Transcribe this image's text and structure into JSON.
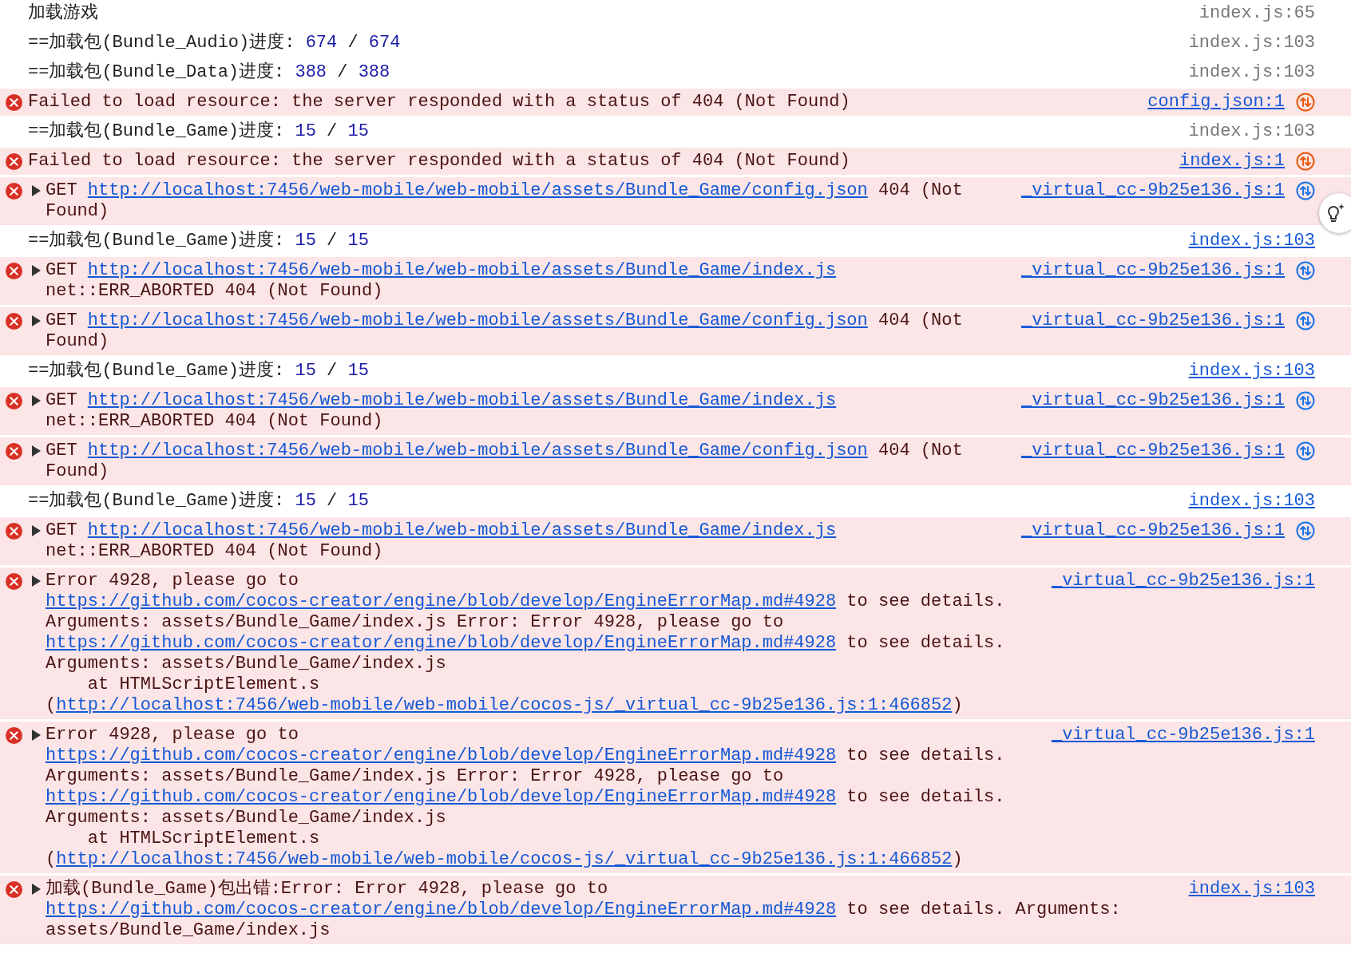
{
  "console": {
    "messages": [
      {
        "kind": "log",
        "parts": [
          {
            "kind": "text",
            "text": "加载游戏"
          }
        ],
        "source": {
          "text": "index.js:65",
          "linked": false
        }
      },
      {
        "kind": "log",
        "parts": [
          {
            "kind": "text",
            "text": "==加载包(Bundle_Audio)进度: "
          },
          {
            "kind": "number",
            "text": "674"
          },
          {
            "kind": "text",
            "text": " / "
          },
          {
            "kind": "number",
            "text": "674"
          }
        ],
        "source": {
          "text": "index.js:103",
          "linked": false
        }
      },
      {
        "kind": "log",
        "parts": [
          {
            "kind": "text",
            "text": "==加载包(Bundle_Data)进度: "
          },
          {
            "kind": "number",
            "text": "388"
          },
          {
            "kind": "text",
            "text": " / "
          },
          {
            "kind": "number",
            "text": "388"
          }
        ],
        "source": {
          "text": "index.js:103",
          "linked": false
        }
      },
      {
        "kind": "error",
        "parts": [
          {
            "kind": "text",
            "text": "Failed to load resource: the server responded with a status of 404 (Not Found)"
          }
        ],
        "source": {
          "text": "config.json:1",
          "linked": true
        },
        "network_icon": {
          "color": "#e8590c"
        }
      },
      {
        "kind": "log",
        "parts": [
          {
            "kind": "text",
            "text": "==加载包(Bundle_Game)进度: "
          },
          {
            "kind": "number",
            "text": "15"
          },
          {
            "kind": "text",
            "text": " / "
          },
          {
            "kind": "number",
            "text": "15"
          }
        ],
        "source": {
          "text": "index.js:103",
          "linked": false
        }
      },
      {
        "kind": "error",
        "parts": [
          {
            "kind": "text",
            "text": "Failed to load resource: the server responded with a status of 404 (Not Found)"
          }
        ],
        "source": {
          "text": "index.js:1",
          "linked": true
        },
        "network_icon": {
          "color": "#e8590c"
        }
      },
      {
        "kind": "error",
        "expanded": false,
        "parts": [
          {
            "kind": "text",
            "text": "GET "
          },
          {
            "kind": "link",
            "text": "http://localhost:7456/web-mobile/web-mobile/assets/Bundle_Game/config.json"
          },
          {
            "kind": "text",
            "text": " 404 (Not Found)"
          }
        ],
        "source": {
          "text": "_virtual_cc-9b25e136.js:1",
          "linked": true
        },
        "network_icon": {
          "color": "#1a73e8"
        }
      },
      {
        "kind": "log",
        "parts": [
          {
            "kind": "text",
            "text": "==加载包(Bundle_Game)进度: "
          },
          {
            "kind": "number",
            "text": "15"
          },
          {
            "kind": "text",
            "text": " / "
          },
          {
            "kind": "number",
            "text": "15"
          }
        ],
        "source": {
          "text": "index.js:103",
          "linked": true
        }
      },
      {
        "kind": "error",
        "expanded": false,
        "parts": [
          {
            "kind": "text",
            "text": "GET "
          },
          {
            "kind": "link",
            "text": "http://localhost:7456/web-mobile/web-mobile/assets/Bundle_Game/index.js"
          },
          {
            "kind": "text",
            "text": " net::ERR_ABORTED 404 (Not Found)"
          }
        ],
        "source": {
          "text": "_virtual_cc-9b25e136.js:1",
          "linked": true
        },
        "network_icon": {
          "color": "#1a73e8"
        }
      },
      {
        "kind": "error",
        "expanded": false,
        "parts": [
          {
            "kind": "text",
            "text": "GET "
          },
          {
            "kind": "link",
            "text": "http://localhost:7456/web-mobile/web-mobile/assets/Bundle_Game/config.json"
          },
          {
            "kind": "text",
            "text": " 404 (Not Found)"
          }
        ],
        "source": {
          "text": "_virtual_cc-9b25e136.js:1",
          "linked": true
        },
        "network_icon": {
          "color": "#1a73e8"
        }
      },
      {
        "kind": "log",
        "parts": [
          {
            "kind": "text",
            "text": "==加载包(Bundle_Game)进度: "
          },
          {
            "kind": "number",
            "text": "15"
          },
          {
            "kind": "text",
            "text": " / "
          },
          {
            "kind": "number",
            "text": "15"
          }
        ],
        "source": {
          "text": "index.js:103",
          "linked": true
        }
      },
      {
        "kind": "error",
        "expanded": false,
        "parts": [
          {
            "kind": "text",
            "text": "GET "
          },
          {
            "kind": "link",
            "text": "http://localhost:7456/web-mobile/web-mobile/assets/Bundle_Game/index.js"
          },
          {
            "kind": "text",
            "text": " net::ERR_ABORTED 404 (Not Found)"
          }
        ],
        "source": {
          "text": "_virtual_cc-9b25e136.js:1",
          "linked": true
        },
        "network_icon": {
          "color": "#1a73e8"
        }
      },
      {
        "kind": "error",
        "expanded": false,
        "parts": [
          {
            "kind": "text",
            "text": "GET "
          },
          {
            "kind": "link",
            "text": "http://localhost:7456/web-mobile/web-mobile/assets/Bundle_Game/config.json"
          },
          {
            "kind": "text",
            "text": " 404 (Not Found)"
          }
        ],
        "source": {
          "text": "_virtual_cc-9b25e136.js:1",
          "linked": true
        },
        "network_icon": {
          "color": "#1a73e8"
        }
      },
      {
        "kind": "log",
        "parts": [
          {
            "kind": "text",
            "text": "==加载包(Bundle_Game)进度: "
          },
          {
            "kind": "number",
            "text": "15"
          },
          {
            "kind": "text",
            "text": " / "
          },
          {
            "kind": "number",
            "text": "15"
          }
        ],
        "source": {
          "text": "index.js:103",
          "linked": true
        }
      },
      {
        "kind": "error",
        "expanded": false,
        "parts": [
          {
            "kind": "text",
            "text": "GET "
          },
          {
            "kind": "link",
            "text": "http://localhost:7456/web-mobile/web-mobile/assets/Bundle_Game/index.js"
          },
          {
            "kind": "text",
            "text": " net::ERR_ABORTED 404 (Not Found)"
          }
        ],
        "source": {
          "text": "_virtual_cc-9b25e136.js:1",
          "linked": true
        },
        "network_icon": {
          "color": "#1a73e8"
        }
      },
      {
        "kind": "error",
        "expanded": false,
        "parts": [
          {
            "kind": "text",
            "text": "Error 4928, please go to "
          },
          {
            "kind": "link",
            "text": "https://github.com/cocos-creator/engine/blob/develop/EngineErrorMap.md#4928"
          },
          {
            "kind": "text",
            "text": " to see details. Arguments: assets/Bundle_Game/index.js Error: Error 4928, please go to "
          },
          {
            "kind": "link",
            "text": "https://github.com/cocos-creator/engine/blob/develop/EngineErrorMap.md#4928"
          },
          {
            "kind": "text",
            "text": " to see details. Arguments: assets/Bundle_Game/index.js\n    at HTMLScriptElement.s ("
          },
          {
            "kind": "link",
            "text": "http://localhost:7456/web-mobile/web-mobile/cocos-js/_virtual_cc-9b25e136.js:1:466852"
          },
          {
            "kind": "text",
            "text": ")"
          }
        ],
        "source": {
          "text": "_virtual_cc-9b25e136.js:1",
          "linked": true
        }
      },
      {
        "kind": "error",
        "expanded": false,
        "parts": [
          {
            "kind": "text",
            "text": "Error 4928, please go to "
          },
          {
            "kind": "link",
            "text": "https://github.com/cocos-creator/engine/blob/develop/EngineErrorMap.md#4928"
          },
          {
            "kind": "text",
            "text": " to see details. Arguments: assets/Bundle_Game/index.js Error: Error 4928, please go to "
          },
          {
            "kind": "link",
            "text": "https://github.com/cocos-creator/engine/blob/develop/EngineErrorMap.md#4928"
          },
          {
            "kind": "text",
            "text": " to see details. Arguments: assets/Bundle_Game/index.js\n    at HTMLScriptElement.s ("
          },
          {
            "kind": "link",
            "text": "http://localhost:7456/web-mobile/web-mobile/cocos-js/_virtual_cc-9b25e136.js:1:466852"
          },
          {
            "kind": "text",
            "text": ")"
          }
        ],
        "source": {
          "text": "_virtual_cc-9b25e136.js:1",
          "linked": true
        }
      },
      {
        "kind": "error",
        "expanded": false,
        "parts": [
          {
            "kind": "text",
            "text": "加载(Bundle_Game)包出错:Error: Error 4928, please go to "
          },
          {
            "kind": "link",
            "text": "https://github.com/cocos-creator/engine/blob/develop/EngineErrorMap.md#4928"
          },
          {
            "kind": "text",
            "text": " to see details. Arguments: assets/Bundle_Game/index.js"
          }
        ],
        "source": {
          "text": "index.js:103",
          "linked": true
        }
      }
    ]
  }
}
